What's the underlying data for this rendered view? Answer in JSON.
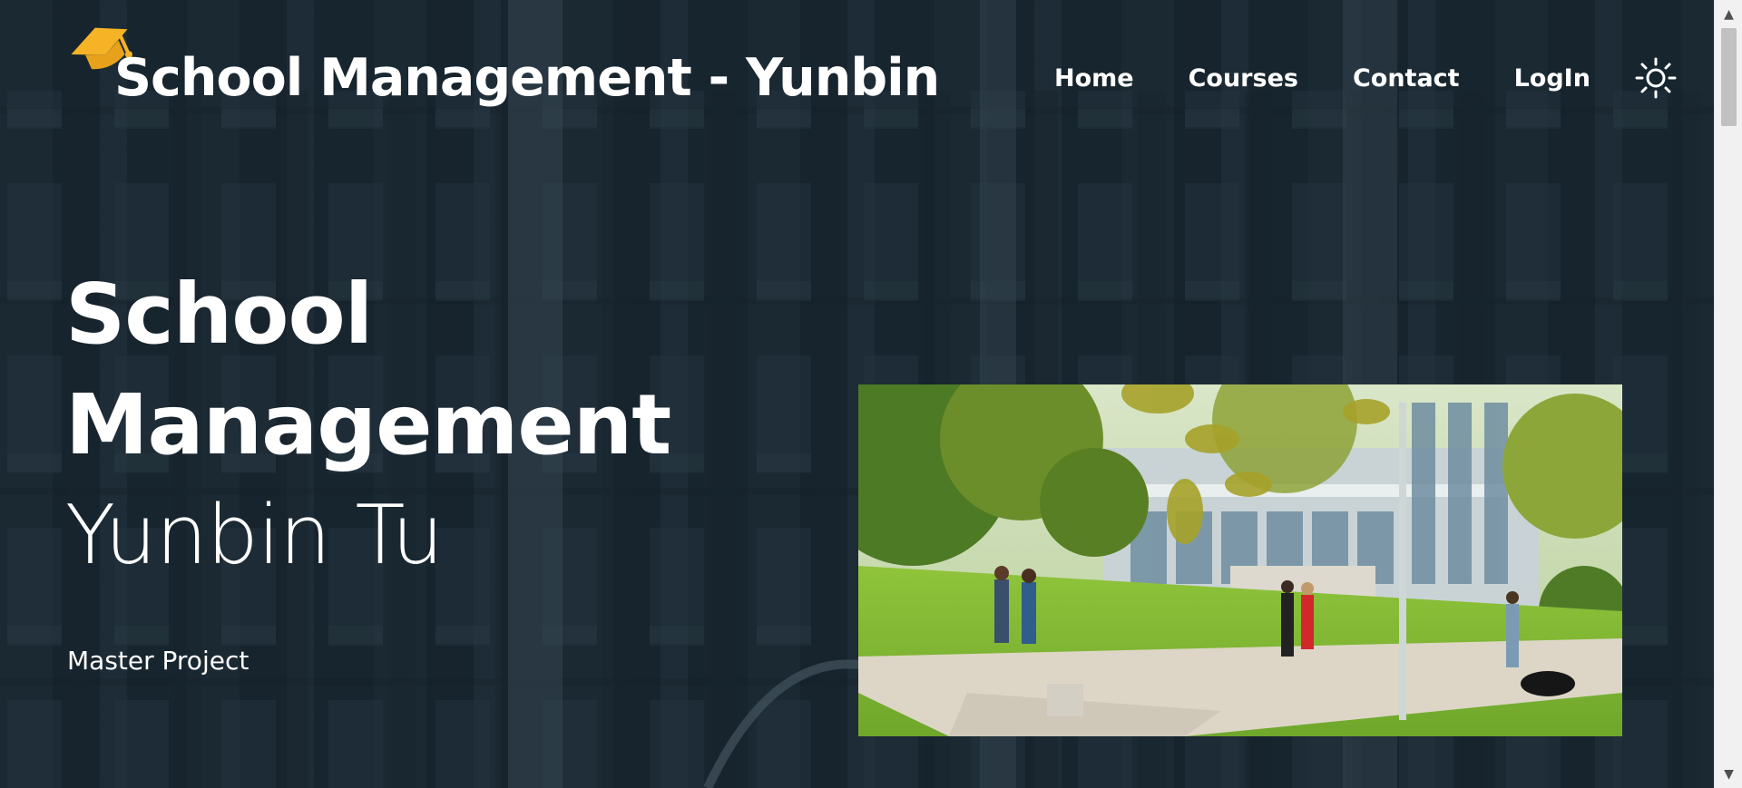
{
  "header": {
    "brand": "School Management - Yunbin",
    "logo_icon": "graduation-cap-icon",
    "logo_color": "#f5b325"
  },
  "nav": {
    "items": [
      {
        "label": "Home"
      },
      {
        "label": "Courses"
      },
      {
        "label": "Contact"
      },
      {
        "label": "LogIn"
      }
    ],
    "theme_toggle_icon": "sun-icon"
  },
  "hero": {
    "title_line1": "School",
    "title_line2": "Management",
    "subtitle": "Yunbin Tu",
    "caption": "Master Project",
    "photo": "campus-photo"
  },
  "colors": {
    "text": "#ffffff",
    "background_overlay": "#1b2a35",
    "accent": "#f5b325"
  }
}
